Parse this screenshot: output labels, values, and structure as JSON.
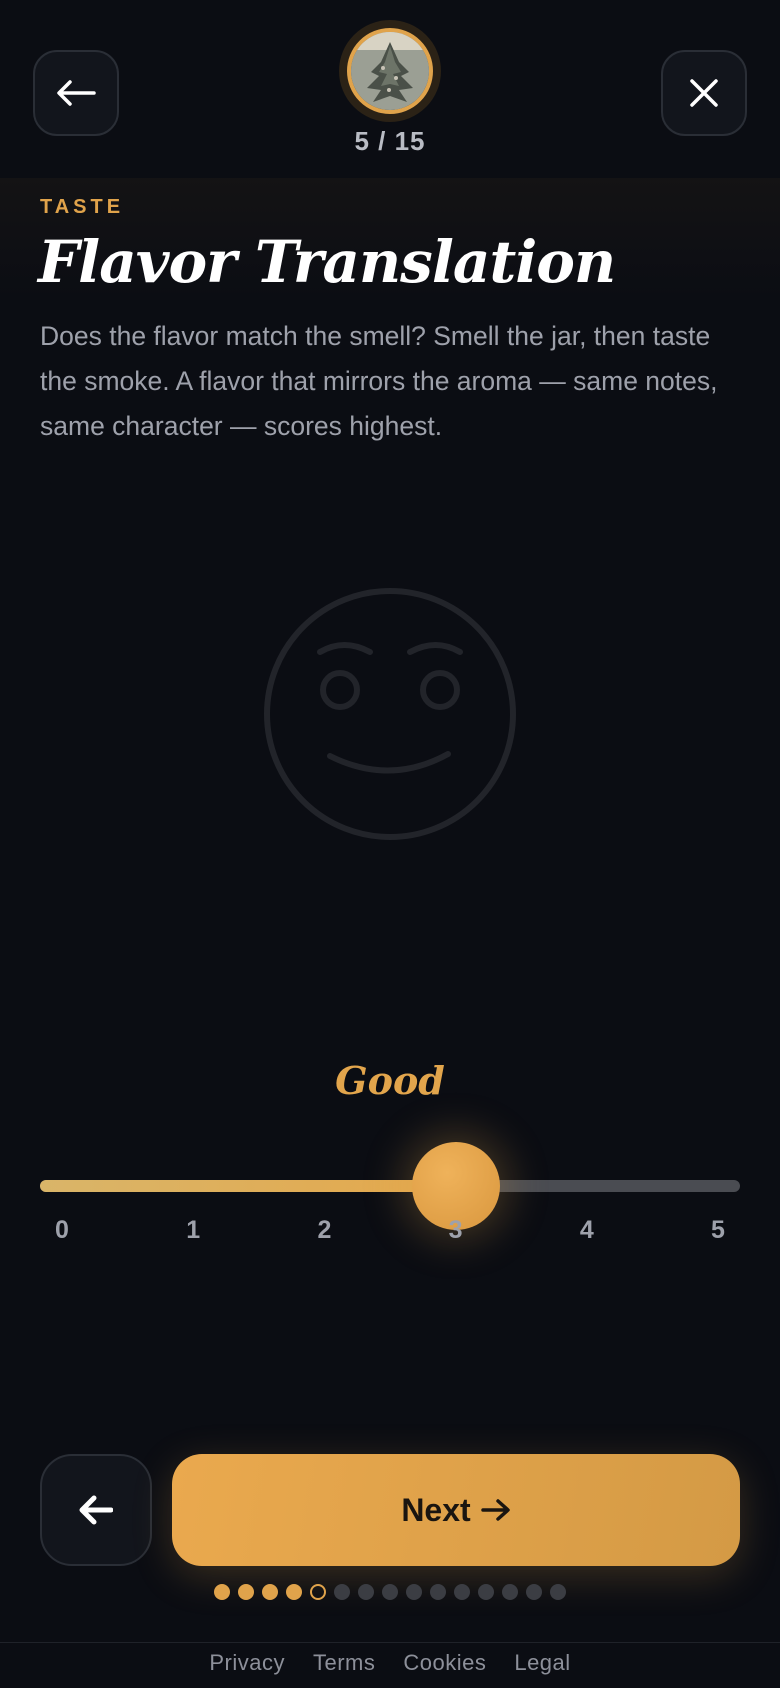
{
  "header": {
    "step_current": 5,
    "step_total": 15,
    "step_text": "5 / 15",
    "back_icon": "arrow-left-icon",
    "close_icon": "close-icon"
  },
  "section": {
    "eyebrow": "TASTE",
    "title": "Flavor Translation",
    "description": "Does the flavor match the smell? Smell the jar, then taste the smoke. A flavor that mirrors the aroma — same notes, same character — scores highest."
  },
  "rating": {
    "label": "Good",
    "value": 3,
    "min": 0,
    "max": 5,
    "ticks": [
      "0",
      "1",
      "2",
      "3",
      "4",
      "5"
    ],
    "face_icon": "smiling-face-icon"
  },
  "navigation": {
    "back_icon": "arrow-left-icon",
    "next_label": "Next",
    "next_icon": "arrow-right-icon"
  },
  "progress_dots": {
    "total": 15,
    "current": 5
  },
  "footer": {
    "links": [
      "Privacy",
      "Terms",
      "Cookies",
      "Legal"
    ]
  },
  "colors": {
    "accent": "#e0a34b",
    "background": "#0b0d13",
    "muted_text": "#9ea1ab"
  }
}
